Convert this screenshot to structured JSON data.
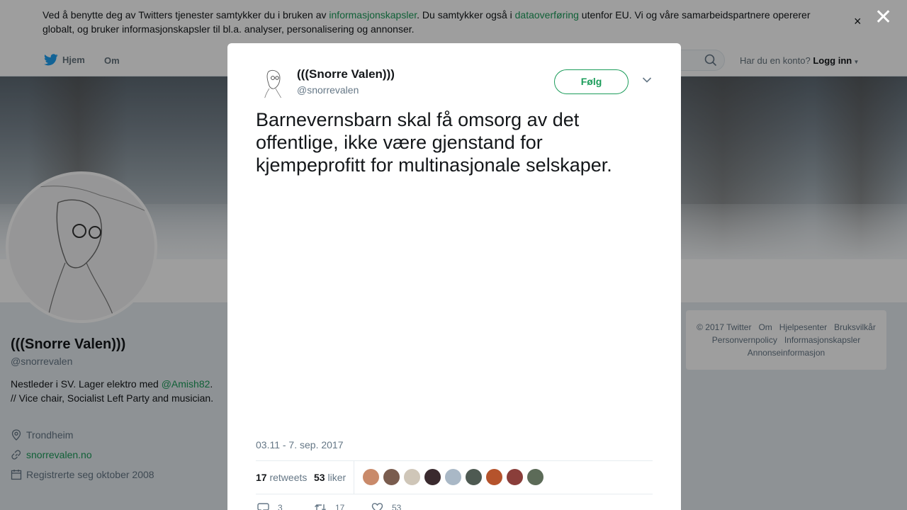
{
  "cookie_banner": {
    "text_1": "Ved å benytte deg av Twitters tjenester samtykker du i bruken av ",
    "link_1": "informasjonskapsler",
    "text_2": ". Du samtykker også i ",
    "link_2": "dataoverføring",
    "text_3": " utenfor EU. Vi og våre samarbeidspartnere opererer globalt, og bruker informasjonskapsler til bl.a. analyser, personalisering og annonser.",
    "close": "×"
  },
  "nav": {
    "home": "Hjem",
    "about": "Om",
    "login_prompt": "Har du en konto?",
    "login": "Logg inn"
  },
  "profile": {
    "name": "(((Snorre Valen)))",
    "handle": "@snorrevalen",
    "bio_1": "Nestleder i SV. Lager elektro med ",
    "bio_mention": "@Amish82",
    "bio_2": ". // Vice chair, Socialist Left Party and musician.",
    "location": "Trondheim",
    "website": "snorrevalen.no",
    "joined": "Registrerte seg oktober 2008"
  },
  "footer": {
    "copyright": "© 2017 Twitter",
    "about": "Om",
    "help": "Hjelpesenter",
    "terms": "Bruksvilkår",
    "privacy": "Personvernpolicy",
    "cookies": "Informasjonskapsler",
    "ads": "Annonseinformasjon"
  },
  "overlay": {
    "close": "✕"
  },
  "tweet": {
    "name": "(((Snorre Valen)))",
    "handle": "@snorrevalen",
    "follow": "Følg",
    "text": "Barnevernsbarn skal få omsorg av det offentlige, ikke være gjenstand for kjempeprofitt for multinasjonale selskaper.",
    "timestamp": "03.11 - 7. sep. 2017",
    "retweets_count": "17",
    "retweets_label": "retweets",
    "likes_count": "53",
    "likes_label": "liker",
    "reply_count": "3",
    "retweet_count": "17",
    "like_count": "53",
    "liker_avatar_colors": [
      "#c98a6a",
      "#7a5c4e",
      "#cfc6b8",
      "#3a2a2e",
      "#a9b8c6",
      "#4e5a52",
      "#b5532c",
      "#8a3e3a",
      "#5c6b58"
    ]
  },
  "colors": {
    "accent": "#1b9c5a",
    "twitter_blue": "#1da1f2",
    "text_secondary": "#657786"
  }
}
